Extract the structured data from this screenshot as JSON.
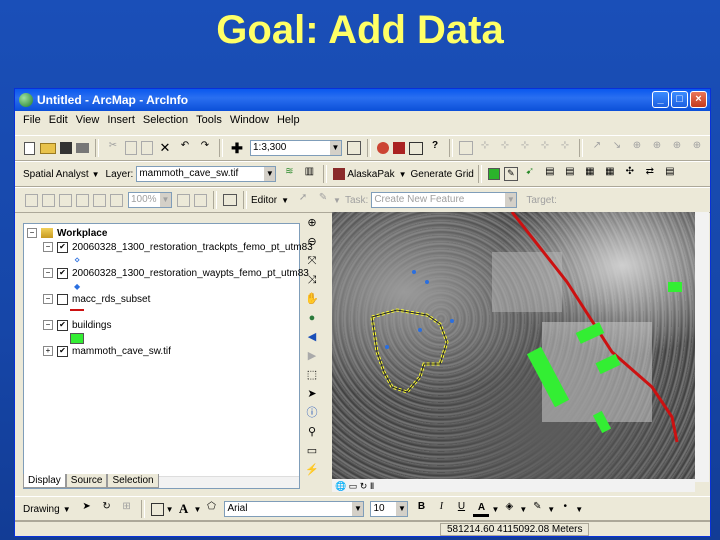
{
  "slide": {
    "title": "Goal: Add Data"
  },
  "window": {
    "title": "Untitled - ArcMap - ArcInfo",
    "min": "_",
    "max": "□",
    "close": "×"
  },
  "menu": [
    "File",
    "Edit",
    "View",
    "Insert",
    "Selection",
    "Tools",
    "Window",
    "Help"
  ],
  "toolbar2": {
    "spatial_analyst": "Spatial Analyst",
    "layer_label": "Layer:",
    "layer_value": "mammoth_cave_sw.tif",
    "scale": "1:3,300",
    "alaska_pak": "AlaskaPak",
    "generate_grid": "Generate Grid"
  },
  "toolbar3": {
    "zoom": "100%",
    "editor": "Editor",
    "task_label": "Task:",
    "task_value": "Create New Feature",
    "target_label": "Target:"
  },
  "toc": {
    "workspace": "Workplace",
    "layers": [
      "20060328_1300_restoration_trackpts_femo_pt_utm83",
      "20060328_1300_restoration_waypts_femo_pt_utm83",
      "macc_rds_subset",
      "buildings",
      "mammoth_cave_sw.tif"
    ],
    "tabs": [
      "Display",
      "Source",
      "Selection"
    ]
  },
  "bottombar": {
    "drawing": "Drawing",
    "font": "Arial",
    "size": "10"
  },
  "status": {
    "coords": "581214.60  4115092.08 Meters"
  },
  "colors": {
    "title": "#ffff66",
    "road": "#cc1111",
    "buildings": "#33ee33",
    "track": "#ffff33",
    "points": "#2a6fe0"
  }
}
